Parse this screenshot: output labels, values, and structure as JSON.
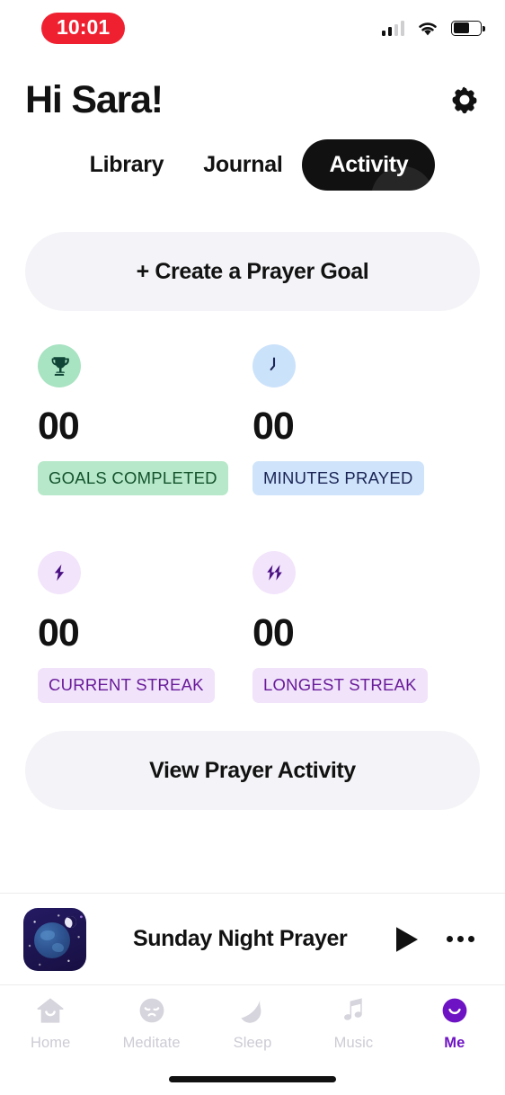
{
  "status_bar": {
    "time": "10:01",
    "time_pill_color": "#ef2131",
    "signal_bars_filled": 2,
    "signal_bars_total": 4,
    "battery_percent": 62,
    "wifi_icon": "wifi-icon",
    "battery_icon": "battery-icon"
  },
  "header": {
    "greeting": "Hi Sara!",
    "settings_icon": "gear-icon"
  },
  "tabs": [
    {
      "label": "Library",
      "active": false
    },
    {
      "label": "Journal",
      "active": false
    },
    {
      "label": "Activity",
      "active": true
    }
  ],
  "actions": {
    "create_goal_label": "+ Create a Prayer Goal",
    "view_activity_label": "View Prayer Activity"
  },
  "stats": [
    {
      "icon": "trophy-icon",
      "value": "00",
      "label": "GOALS COMPLETED",
      "icon_bg": "#a8e3c2",
      "icon_color": "#0f4436",
      "badge_bg": "#b6e8c9",
      "badge_color": "#14532d"
    },
    {
      "icon": "clock-icon",
      "value": "00",
      "label": "MINUTES PRAYED",
      "icon_bg": "#cbe2fb",
      "icon_color": "#1a2456",
      "badge_bg": "#cfe4fa",
      "badge_color": "#1a2456"
    },
    {
      "icon": "lightning-bolt-icon",
      "value": "00",
      "label": "CURRENT STREAK",
      "icon_bg": "#f2e4fb",
      "icon_color": "#4a0f82",
      "badge_bg": "#f0e3fa",
      "badge_color": "#6a1b9a"
    },
    {
      "icon": "double-lightning-bolt-icon",
      "value": "00",
      "label": "LONGEST STREAK",
      "icon_bg": "#f2e4fb",
      "icon_color": "#4a0f82",
      "badge_bg": "#f0e3fa",
      "badge_color": "#6a1b9a"
    }
  ],
  "now_playing": {
    "title": "Sunday Night Prayer",
    "artwork": "night-sky-globe-artwork",
    "play_icon": "play-icon",
    "more_icon": "more-options-icon"
  },
  "bottom_nav": [
    {
      "label": "Home",
      "icon": "house-icon",
      "active": false
    },
    {
      "label": "Meditate",
      "icon": "meditating-face-icon",
      "active": false
    },
    {
      "label": "Sleep",
      "icon": "crescent-moon-icon",
      "active": false
    },
    {
      "label": "Music",
      "icon": "music-note-icon",
      "active": false
    },
    {
      "label": "Me",
      "icon": "smiling-face-icon",
      "active": true
    }
  ],
  "theme": {
    "accent": "#6e13c4",
    "pill_bg": "#f4f3f7",
    "active_tab_bg": "#111111",
    "text": "#121212",
    "inactive_nav": "#cdcbd4"
  }
}
